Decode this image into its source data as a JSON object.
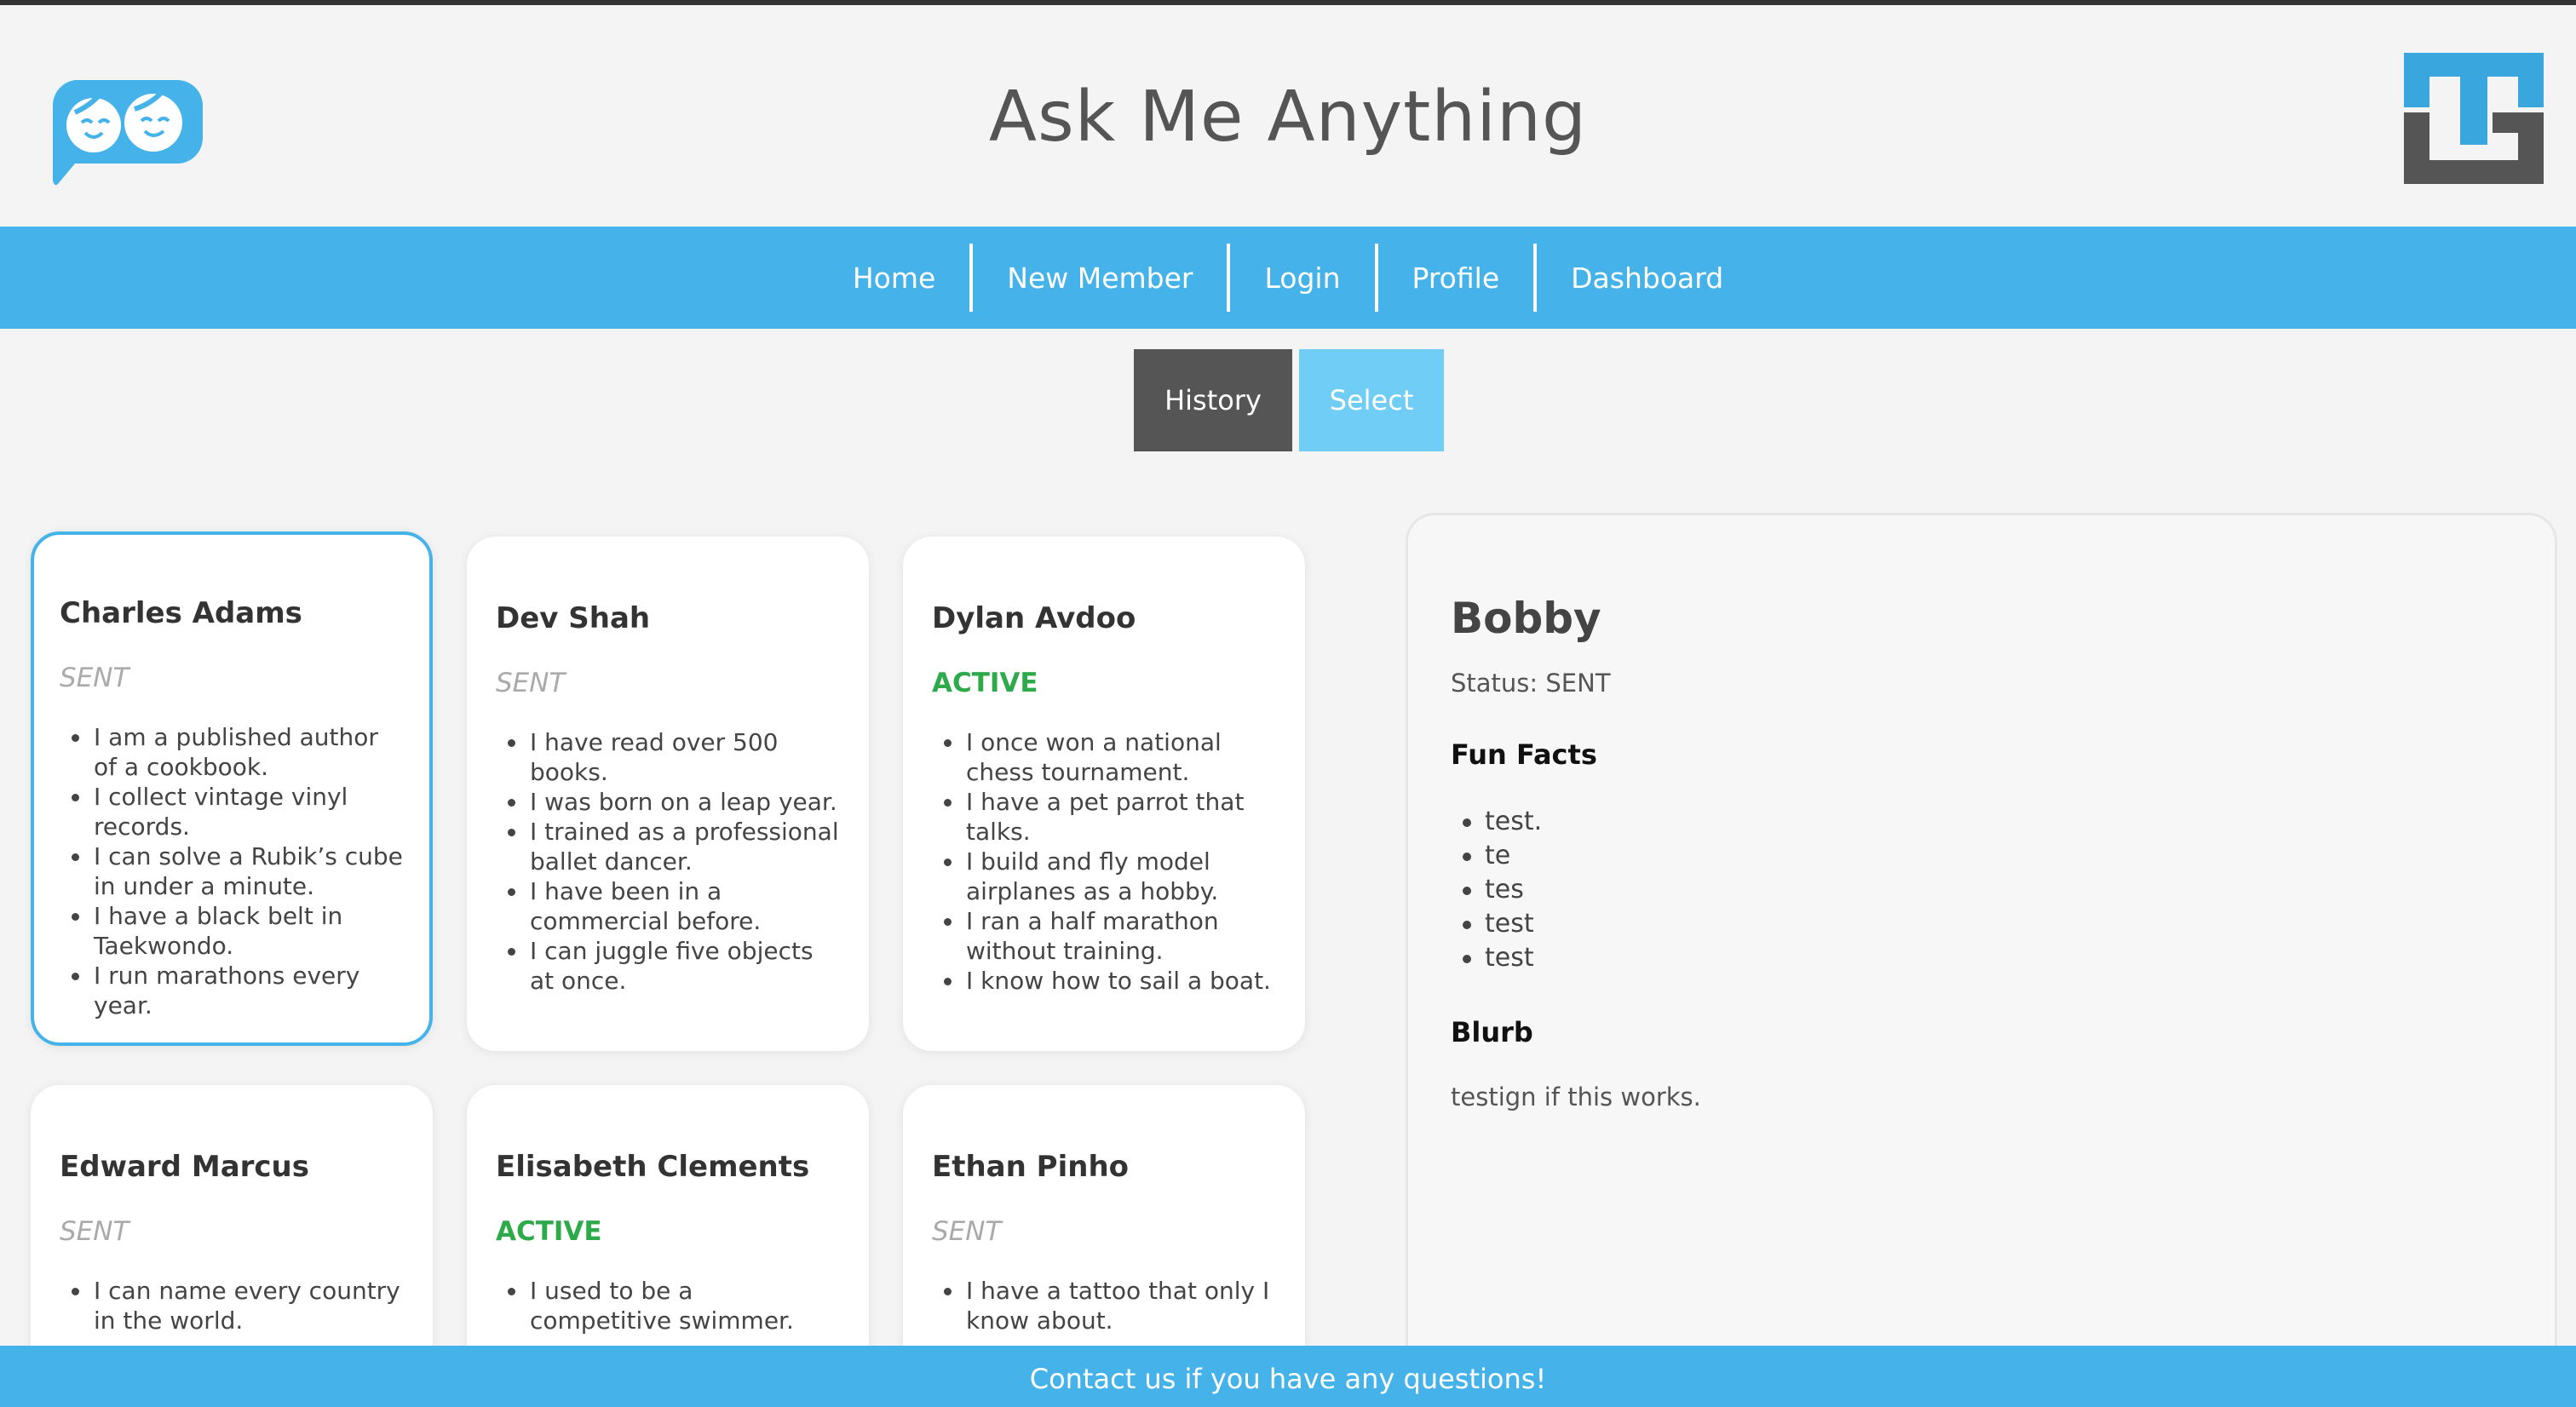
{
  "header": {
    "title": "Ask Me Anything",
    "logo_left": "chat-faces-logo",
    "logo_right": "tg-logo"
  },
  "nav": {
    "items": [
      {
        "label": "Home"
      },
      {
        "label": "New Member"
      },
      {
        "label": "Login"
      },
      {
        "label": "Profile"
      },
      {
        "label": "Dashboard"
      }
    ]
  },
  "toggle": {
    "history": "History",
    "select": "Select"
  },
  "members": [
    {
      "name": "Charles Adams",
      "status": "SENT",
      "facts": [
        "I am a published author of a cookbook.",
        "I collect vintage vinyl records.",
        "I can solve a Rubik’s cube in under a minute.",
        "I have a black belt in Taekwondo.",
        "I run marathons every year."
      ]
    },
    {
      "name": "Dev Shah",
      "status": "SENT",
      "facts": [
        "I have read over 500 books.",
        "I was born on a leap year.",
        "I trained as a professional ballet dancer.",
        "I have been in a commercial before.",
        "I can juggle five objects at once."
      ]
    },
    {
      "name": "Dylan Avdoo",
      "status": "ACTIVE",
      "facts": [
        "I once won a national chess tournament.",
        "I have a pet parrot that talks.",
        "I build and fly model airplanes as a hobby.",
        "I ran a half marathon without training.",
        "I know how to sail a boat."
      ]
    },
    {
      "name": "Edward Marcus",
      "status": "SENT",
      "facts": [
        "I can name every country in the world."
      ]
    },
    {
      "name": "Elisabeth Clements",
      "status": "ACTIVE",
      "facts": [
        "I used to be a competitive swimmer."
      ]
    },
    {
      "name": "Ethan Pinho",
      "status": "SENT",
      "facts": [
        "I have a tattoo that only I know about."
      ]
    }
  ],
  "detail": {
    "name": "Bobby",
    "status_line": "Status: SENT",
    "fun_facts_heading": "Fun Facts",
    "fun_facts": [
      "test.",
      "te",
      "tes",
      "test",
      "test"
    ],
    "blurb_heading": "Blurb",
    "blurb": "testign if this works."
  },
  "footer": {
    "text": "Contact us if you have any questions!"
  },
  "colors": {
    "accent": "#45b3ea",
    "active_status": "#2eaa4a",
    "history_button": "#555555",
    "select_button": "#6fcdf6"
  }
}
